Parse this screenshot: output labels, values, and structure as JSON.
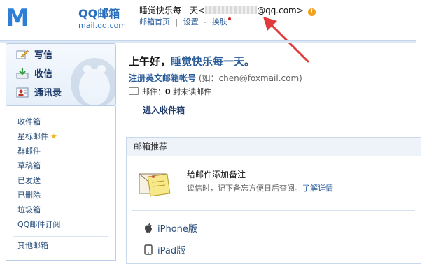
{
  "brand": {
    "logo_text": "Mail",
    "product_name": "QQ邮箱",
    "domain": "mail.qq.com"
  },
  "account": {
    "nickname_prefix": "睡觉快乐每一天<",
    "email_suffix": "@qq.com>",
    "warning_glyph": "!",
    "warning_color": "#f0a21c"
  },
  "top_links": {
    "home": "邮箱首页",
    "separator": "|",
    "settings": "设置",
    "dash": "-",
    "skin": "换肤"
  },
  "sidebar": {
    "primary": [
      {
        "label": "写信",
        "icon": "compose-icon"
      },
      {
        "label": "收信",
        "icon": "inbox-download-icon"
      },
      {
        "label": "通讯录",
        "icon": "contacts-icon"
      }
    ],
    "folders": [
      {
        "label": "收件箱"
      },
      {
        "label": "星标邮件",
        "badge": "★"
      },
      {
        "label": "群邮件"
      },
      {
        "label": "草稿箱"
      },
      {
        "label": "已发送"
      },
      {
        "label": "已删除"
      },
      {
        "label": "垃圾箱"
      },
      {
        "label": "QQ邮件订阅"
      }
    ],
    "other": [
      {
        "label": "其他邮箱"
      }
    ]
  },
  "main": {
    "greeting_prefix": "上午好，",
    "greeting_name": "睡觉快乐每一天。",
    "register_link": "注册英文邮箱帐号",
    "register_hint": "(如：chen@foxmail.com)",
    "mail_label": "邮件：",
    "unread_count": "0",
    "unread_suffix": "封未读邮件",
    "enter_inbox": "进入收件箱"
  },
  "recommend": {
    "header": "邮箱推荐",
    "note_title": "给邮件添加备注",
    "note_desc": "读信时，记下备忘方便日后查阅。",
    "note_link": "了解详情",
    "platforms": [
      {
        "label": "iPhone版",
        "icon": "apple-icon"
      },
      {
        "label": "iPad版",
        "icon": "tablet-icon"
      }
    ]
  },
  "colors": {
    "brand_blue": "#2d7fd6",
    "link_blue": "#2b5c9a",
    "annotation_arrow": "#e03a3a"
  }
}
